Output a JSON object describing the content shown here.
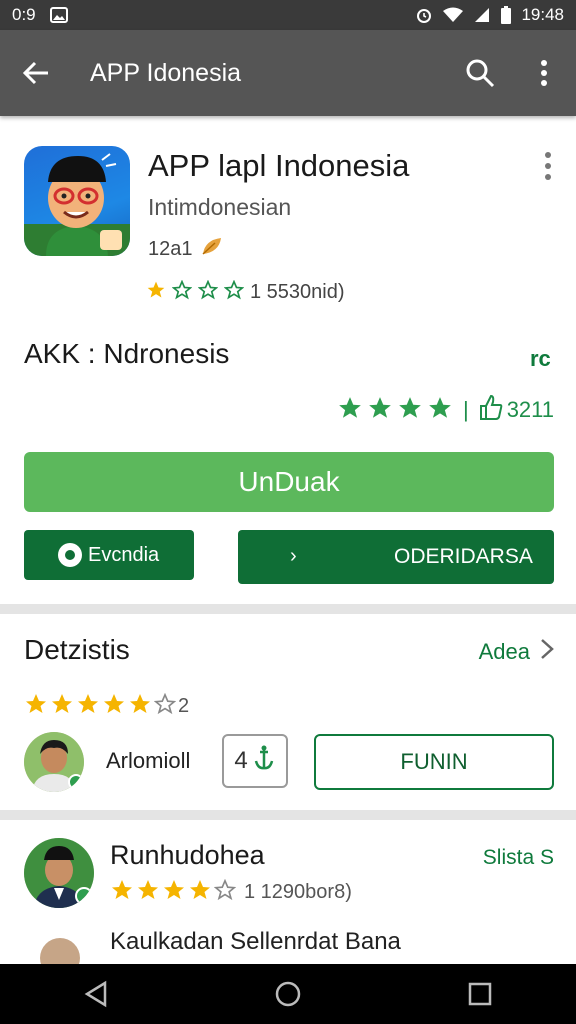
{
  "status_bar": {
    "time_left": "0:9",
    "time_right": "19:48",
    "icons": [
      "photo-icon",
      "alarm-icon",
      "wifi-icon",
      "signal-icon",
      "battery-icon"
    ]
  },
  "toolbar": {
    "title": "APP Idonesia",
    "icons": [
      "back-arrow-icon",
      "search-icon",
      "more-vert-icon"
    ]
  },
  "app": {
    "name": "APP lapl Indonesia",
    "developer": "Intimdonesian",
    "size": "12a1",
    "rating_text": "1 5530nid)",
    "section_title": "AKK : Ndronesis",
    "section_icon": "rc",
    "rating_value": "4",
    "review_count": "3211",
    "install_label": "UnDuak",
    "left_button_label": "Evcndia",
    "right_button_label": "ODERIDARSA",
    "colors": {
      "install": "#5cb85c",
      "dark_green": "#0f6e36",
      "accent_text": "#0f7a3c",
      "star": "#f5b400"
    }
  },
  "details": {
    "title": "Detzistis",
    "link_label": "Adea",
    "stars": 5,
    "stars_suffix": "2",
    "author": "Arlomioll",
    "count_box": "4",
    "button_label": "FUNIN"
  },
  "review": {
    "name": "Runhudohea",
    "status": "Slista S",
    "stars": 4,
    "rating_text": "1 1290bor8)",
    "text": "Kaulkadan Sellenrdat Bana"
  },
  "navbar": {
    "icons": [
      "back-triangle-icon",
      "home-circle-icon",
      "recents-square-icon"
    ]
  }
}
